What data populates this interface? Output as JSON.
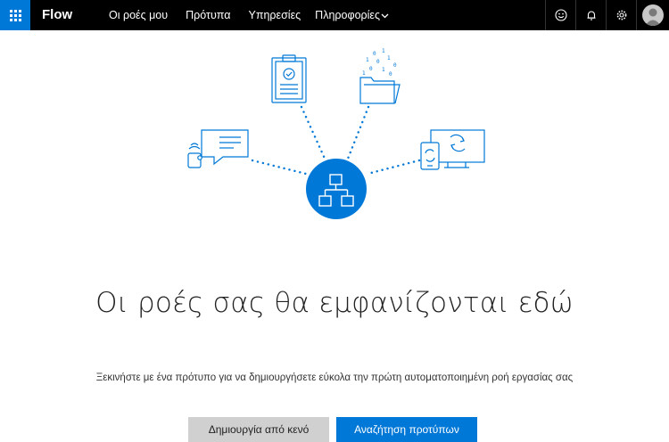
{
  "app": {
    "name": "Flow"
  },
  "nav": {
    "items": [
      {
        "label": "Οι ροές μου"
      },
      {
        "label": "Πρότυπα"
      },
      {
        "label": "Υπηρεσίες"
      },
      {
        "label": "Πληροφορίες",
        "has_dropdown": true
      }
    ]
  },
  "header_icons": [
    "smiley-icon",
    "bell-icon",
    "gear-icon",
    "avatar"
  ],
  "empty_state": {
    "title": "Οι ροές σας θα εμφανίζονται εδώ",
    "description": "Ξεκινήστε με ένα πρότυπο για να δημιουργήσετε εύκολα την πρώτη αυτοματοποιημένη ροή εργασίας σας"
  },
  "buttons": {
    "create_blank": "Δημιουργία από κενό",
    "search_templates": "Αναζήτηση προτύπων"
  },
  "colors": {
    "accent": "#0078d7",
    "topbar": "#000000",
    "secondary_button": "#d0d0d0"
  }
}
